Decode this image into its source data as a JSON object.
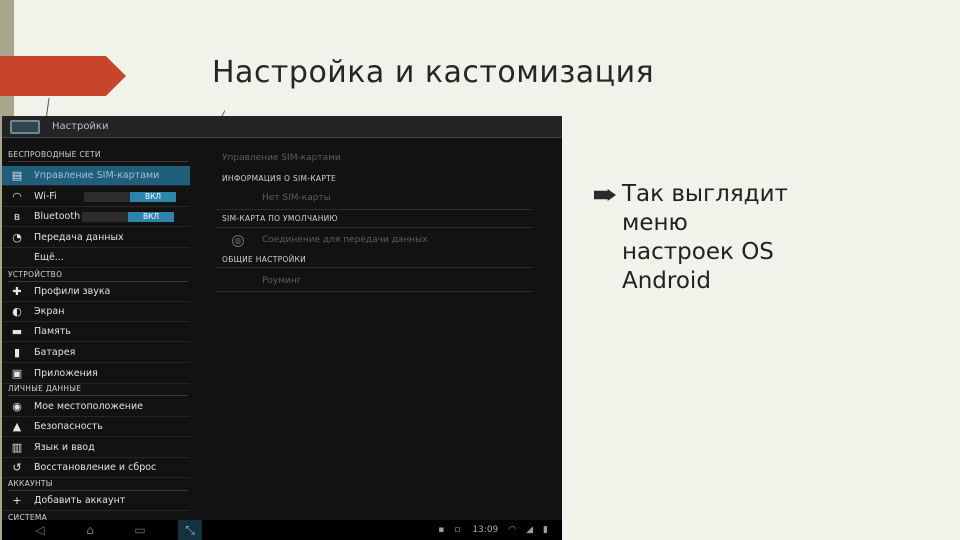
{
  "slide": {
    "title": "Настройка и кастомизация",
    "bullet_text": "Так выглядит меню настроек OS Android"
  },
  "colors": {
    "accent_arrow": "#c8442a",
    "selected_row": "#1f5f7c",
    "toggle_on": "#2b85ad"
  },
  "android": {
    "action_bar_title": "Настройки",
    "sections": [
      {
        "header": "БЕСПРОВОДНЫЕ СЕТИ"
      },
      {
        "header": "УСТРОЙСТВО"
      },
      {
        "header": "ЛИЧНЫЕ ДАННЫЕ"
      },
      {
        "header": "АККАУНТЫ"
      },
      {
        "header": "СИСТЕМА"
      }
    ],
    "items": [
      {
        "label": "Управление SIM-картами",
        "icon": "sim-card-icon",
        "selected": true
      },
      {
        "label": "Wi-Fi",
        "icon": "wifi-icon",
        "toggle": "ВКЛ"
      },
      {
        "label": "Bluetooth",
        "icon": "bluetooth-icon",
        "toggle": "ВКЛ"
      },
      {
        "label": "Передача данных",
        "icon": "data-usage-icon"
      },
      {
        "label": "Ещё...",
        "icon": ""
      },
      {
        "label": "Профили звука",
        "icon": "sound-icon"
      },
      {
        "label": "Экран",
        "icon": "display-icon"
      },
      {
        "label": "Память",
        "icon": "storage-icon"
      },
      {
        "label": "Батарея",
        "icon": "battery-icon"
      },
      {
        "label": "Приложения",
        "icon": "apps-icon"
      },
      {
        "label": "Мое местоположение",
        "icon": "location-icon"
      },
      {
        "label": "Безопасность",
        "icon": "lock-icon"
      },
      {
        "label": "Язык и ввод",
        "icon": "language-icon"
      },
      {
        "label": "Восстановление и сброс",
        "icon": "backup-icon"
      },
      {
        "label": "Добавить аккаунт",
        "icon": "add-icon"
      }
    ],
    "detail": {
      "title": "Управление SIM-картами",
      "sim_info_header": "ИНФОРМАЦИЯ О SIM-КАРТЕ",
      "no_sim": "Нет SIM-карты",
      "default_sim_header": "SIM-КАРТА ПО УМОЛЧАНИЮ",
      "data_connection": "Соединение для передачи данных",
      "general_header": "ОБЩИЕ НАСТРОЙКИ",
      "roaming": "Роуминг"
    },
    "status": {
      "time": "13:09"
    }
  }
}
